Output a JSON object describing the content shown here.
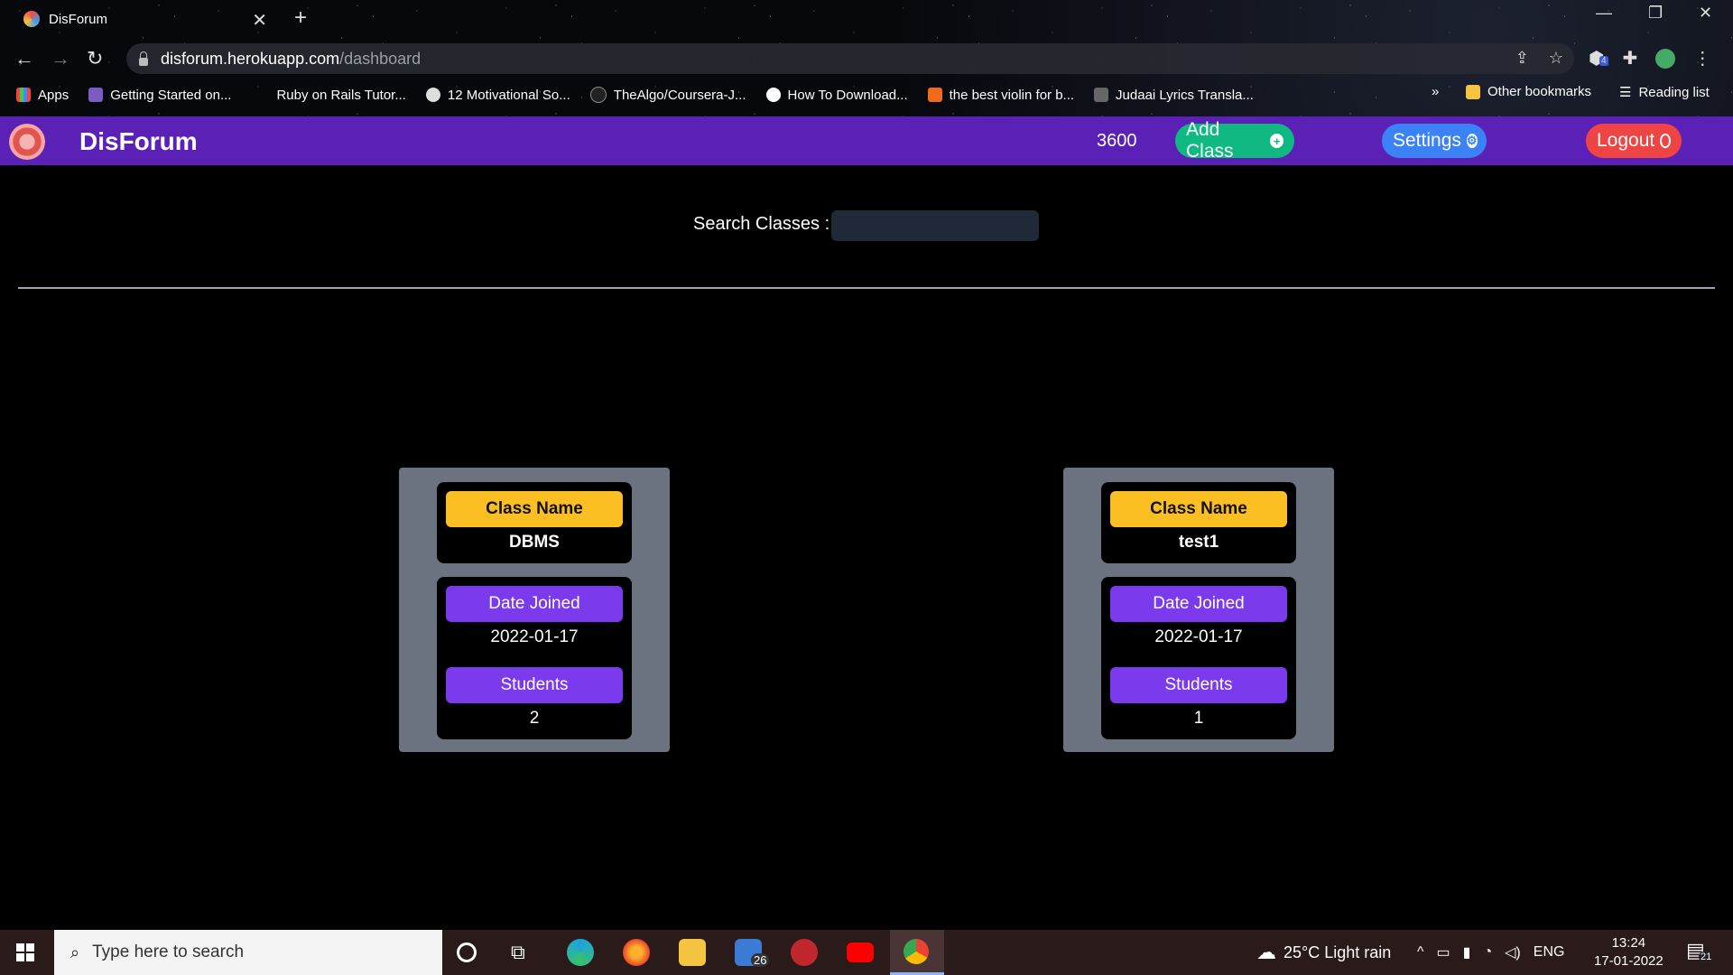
{
  "browser": {
    "tab_title": "DisForum",
    "url_host": "disforum.herokuapp.com",
    "url_path": "/dashboard",
    "bookmarks": [
      {
        "label": "Apps"
      },
      {
        "label": "Getting Started on..."
      },
      {
        "label": "Ruby on Rails Tutor..."
      },
      {
        "label": "12 Motivational So..."
      },
      {
        "label": "TheAlgo/Coursera-J..."
      },
      {
        "label": "How To Download..."
      },
      {
        "label": "the best violin for b..."
      },
      {
        "label": "Judaai Lyrics Transla..."
      }
    ],
    "more": "»",
    "other_bookmarks": "Other bookmarks",
    "reading_list": "Reading list",
    "extension_badge": "4"
  },
  "navbar": {
    "brand": "DisForum",
    "points": "3600",
    "add_class": "Add Class",
    "settings": "Settings",
    "logout": "Logout"
  },
  "search": {
    "label": "Search Classes :",
    "value": ""
  },
  "classes": [
    {
      "name_label": "Class Name",
      "name": "DBMS",
      "date_label": "Date Joined",
      "date": "2022-01-17",
      "students_label": "Students",
      "students": "2"
    },
    {
      "name_label": "Class Name",
      "name": "test1",
      "date_label": "Date Joined",
      "date": "2022-01-17",
      "students_label": "Students",
      "students": "1"
    }
  ],
  "taskbar": {
    "search_placeholder": "Type here to search",
    "mail_badge": "26",
    "weather": "25°C  Light rain",
    "lang": "ENG",
    "time": "13:24",
    "date": "17-01-2022",
    "notif_badge": "21"
  },
  "colors": {
    "navbar": "#5b21b6",
    "add_class": "#10b981",
    "settings": "#3b82f6",
    "logout": "#ef4444",
    "class_name_label": "#fbbf24",
    "purple_label": "#7c3aed",
    "card_bg": "#6b7280"
  }
}
